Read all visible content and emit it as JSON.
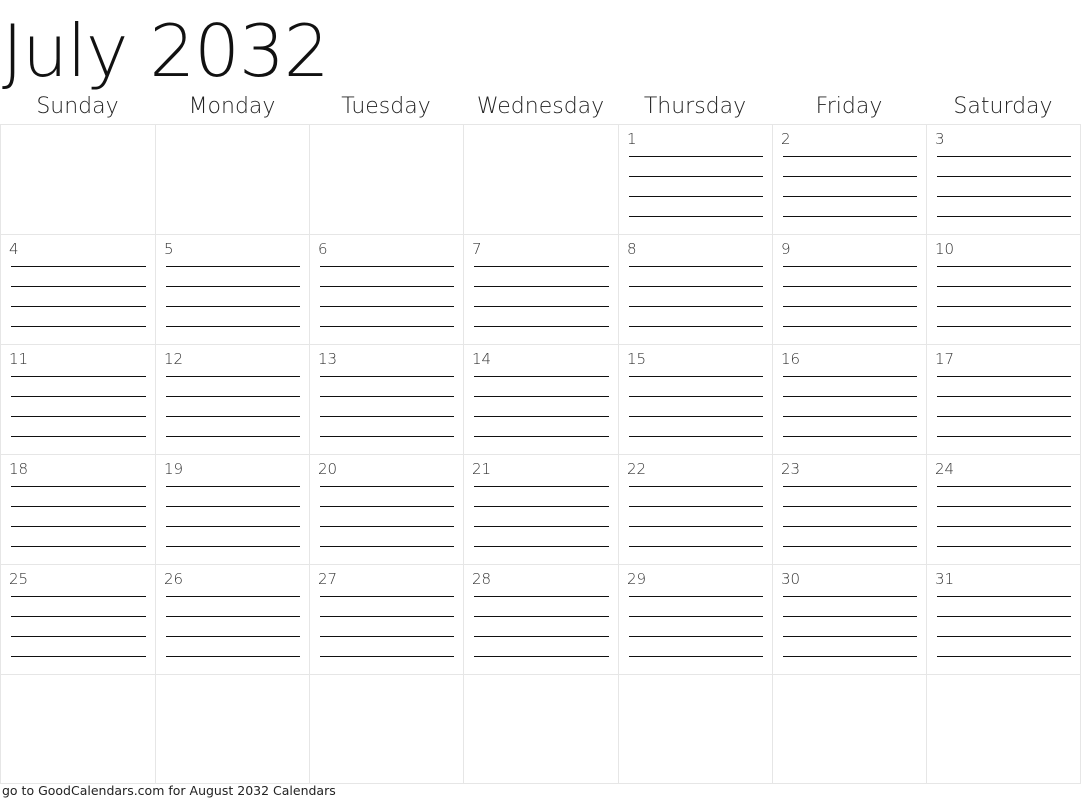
{
  "title": "July 2032",
  "weekdays": [
    "Sunday",
    "Monday",
    "Tuesday",
    "Wednesday",
    "Thursday",
    "Friday",
    "Saturday"
  ],
  "weeks": [
    [
      "",
      "",
      "",
      "",
      "1",
      "2",
      "3"
    ],
    [
      "4",
      "5",
      "6",
      "7",
      "8",
      "9",
      "10"
    ],
    [
      "11",
      "12",
      "13",
      "14",
      "15",
      "16",
      "17"
    ],
    [
      "18",
      "19",
      "20",
      "21",
      "22",
      "23",
      "24"
    ],
    [
      "25",
      "26",
      "27",
      "28",
      "29",
      "30",
      "31"
    ],
    [
      "",
      "",
      "",
      "",
      "",
      "",
      ""
    ]
  ],
  "writing_lines_per_day": 4,
  "footer": "go to GoodCalendars.com for August 2032 Calendars",
  "colors": {
    "grid": "#e6e6e6",
    "text": "#111111",
    "lines": "#111111"
  }
}
